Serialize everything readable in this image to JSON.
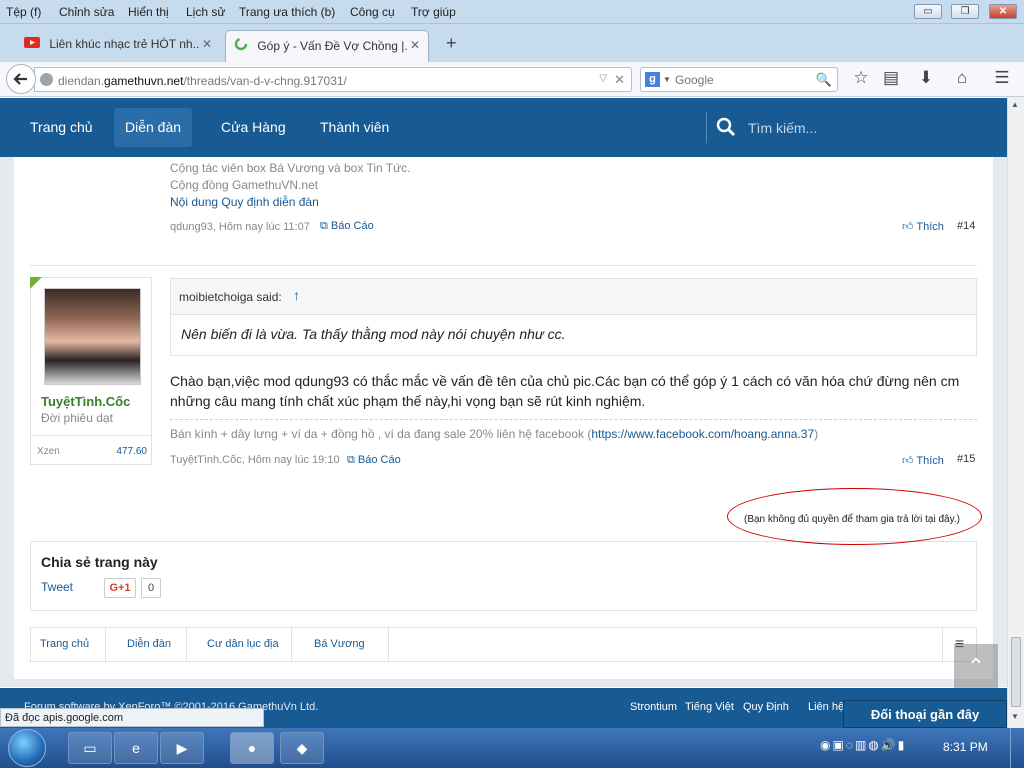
{
  "menu": [
    "Tệp (f)",
    "Chỉnh sửa",
    "Hiển thị",
    "Lịch sử",
    "Trang ưa thích (b)",
    "Công cụ",
    "Trợ giúp"
  ],
  "window_controls": {
    "minimize": "▭",
    "restore": "❐",
    "close": "✕"
  },
  "tabs": [
    {
      "title": "Liên khúc nhạc trẻ HÓT nh...",
      "icon": "youtube-icon",
      "active": false
    },
    {
      "title": "Góp ý - Vấn Đề Vợ Chồng |...",
      "icon": "loading-icon",
      "active": true
    }
  ],
  "url": {
    "prefix": "diendan.",
    "domain": "gamethuvn.net",
    "path": "/threads/van-d-v-chng.917031/"
  },
  "browser_search": {
    "engine_letter": "g",
    "placeholder": "Google"
  },
  "site_nav": [
    "Trang chủ",
    "Diễn đàn",
    "Cửa Hàng",
    "Thành viên"
  ],
  "site_nav_active": "Diễn đàn",
  "site_search_placeholder": "Tìm kiếm...",
  "post14": {
    "signature_lines": [
      "Cộng tác viên box Bá Vương và box Tin Tức.",
      "Cộng đồng GamethuVN.net"
    ],
    "signature_link": "Nội dung Quy định diễn đàn",
    "meta": "qdung93, Hôm nay lúc 11:07",
    "report": "Báo Cáo",
    "like": "Thích",
    "number": "#14"
  },
  "post15": {
    "user": {
      "name": "TuyệtTình.Cốc",
      "title": "Đời phiêu dạt",
      "stat_label": "Xzen",
      "stat_value": "477.60"
    },
    "quote": {
      "author": "moibietchoiga said:",
      "arrow": "↑",
      "text": "Nên biến đi là vừa. Ta thấy thằng mod này nói chuyện như cc."
    },
    "message": "Chào bạn,việc mod qdung93 có thắc mắc về vấn đề tên của chủ pic.Các bạn có thể góp ý 1 cách có văn hóa chứ đừng nên cm những câu mang tính chất xúc phạm thế này,hi vọng bạn sẽ rút kinh nghiệm.",
    "signature_text": "Bán kính + dây lưng + ví da + đồng hồ , ví da đang sale 20% liên hệ facebook (",
    "signature_link": "https://www.facebook.com/hoang.anna.37",
    "signature_close": ")",
    "meta": "TuyệtTình.Cốc, Hôm nay lúc 19:10",
    "report": "Báo Cáo",
    "like": "Thích",
    "number": "#15"
  },
  "no_permission": "(Bạn không đủ quyền để tham gia trả lời tại đây.)",
  "share": {
    "title": "Chia sẻ trang này",
    "tweet": "Tweet",
    "gplus": "G+1",
    "count": "0"
  },
  "breadcrumb": [
    "Trang chủ",
    "Diễn đàn",
    "Cư dân lục địa",
    "Bá Vương"
  ],
  "footer": {
    "copyright": "Forum software by XenForo™ ©2001-2016 GamethuVn Ltd.",
    "links": [
      "Strontium",
      "Tiếng Việt",
      "Quy Định",
      "Liên hệ"
    ]
  },
  "chat": "Đối thoại gần đây",
  "status": "Đã đọc apis.google.com",
  "clock": "8:31 PM",
  "colors": {
    "header_blue": "#185a94",
    "nav_active": "#2b6da8",
    "link": "#185a94",
    "username_green": "#3a7d2c",
    "annotation_red": "#cc0000"
  }
}
